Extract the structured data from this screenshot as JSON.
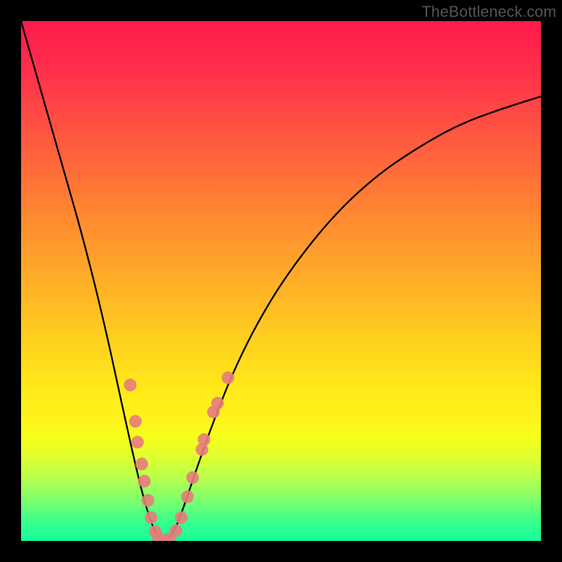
{
  "watermark": {
    "text": "TheBottleneck.com"
  },
  "colors": {
    "curve_stroke": "#000000",
    "marker_fill": "#e77c7c",
    "marker_stroke": "#e77c7c",
    "background_black": "#000000"
  },
  "chart_data": {
    "type": "line",
    "title": "",
    "xlabel": "",
    "ylabel": "",
    "xlim": [
      0,
      1
    ],
    "ylim": [
      0,
      1
    ],
    "series": [
      {
        "name": "bottleneck-curve",
        "x": [
          0.0,
          0.04,
          0.08,
          0.12,
          0.16,
          0.2,
          0.226,
          0.242,
          0.258,
          0.274,
          0.29,
          0.306,
          0.338,
          0.37,
          0.41,
          0.46,
          0.52,
          0.6,
          0.68,
          0.76,
          0.84,
          0.92,
          1.0
        ],
        "y": [
          1.0,
          0.86,
          0.72,
          0.58,
          0.42,
          0.235,
          0.12,
          0.06,
          0.015,
          0.0,
          0.01,
          0.045,
          0.14,
          0.23,
          0.33,
          0.43,
          0.525,
          0.625,
          0.7,
          0.755,
          0.8,
          0.83,
          0.855
        ]
      }
    ],
    "markers": [
      {
        "series": "bottleneck-curve",
        "x": 0.21,
        "y": 0.3
      },
      {
        "series": "bottleneck-curve",
        "x": 0.22,
        "y": 0.23
      },
      {
        "series": "bottleneck-curve",
        "x": 0.224,
        "y": 0.19
      },
      {
        "series": "bottleneck-curve",
        "x": 0.232,
        "y": 0.148
      },
      {
        "series": "bottleneck-curve",
        "x": 0.237,
        "y": 0.115
      },
      {
        "series": "bottleneck-curve",
        "x": 0.244,
        "y": 0.078
      },
      {
        "series": "bottleneck-curve",
        "x": 0.25,
        "y": 0.045
      },
      {
        "series": "bottleneck-curve",
        "x": 0.258,
        "y": 0.018
      },
      {
        "series": "bottleneck-curve",
        "x": 0.264,
        "y": 0.006
      },
      {
        "series": "bottleneck-curve",
        "x": 0.274,
        "y": 0.0
      },
      {
        "series": "bottleneck-curve",
        "x": 0.285,
        "y": 0.004
      },
      {
        "series": "bottleneck-curve",
        "x": 0.298,
        "y": 0.02
      },
      {
        "series": "bottleneck-curve",
        "x": 0.308,
        "y": 0.045
      },
      {
        "series": "bottleneck-curve",
        "x": 0.32,
        "y": 0.085
      },
      {
        "series": "bottleneck-curve",
        "x": 0.33,
        "y": 0.122
      },
      {
        "series": "bottleneck-curve",
        "x": 0.348,
        "y": 0.176
      },
      {
        "series": "bottleneck-curve",
        "x": 0.352,
        "y": 0.195
      },
      {
        "series": "bottleneck-curve",
        "x": 0.37,
        "y": 0.248
      },
      {
        "series": "bottleneck-curve",
        "x": 0.378,
        "y": 0.265
      },
      {
        "series": "bottleneck-curve",
        "x": 0.398,
        "y": 0.314
      }
    ]
  }
}
